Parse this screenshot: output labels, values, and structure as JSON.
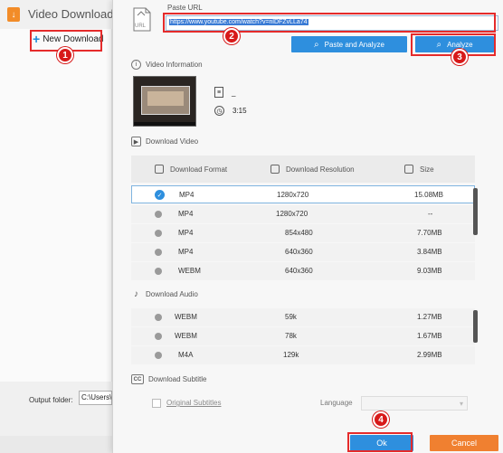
{
  "app": {
    "title": "Video Downloader",
    "new_download_label": "New Download",
    "output_folder_label": "Output folder:",
    "output_folder_value": "C:\\Users\\"
  },
  "dialog": {
    "url_icon_text": "URL",
    "paste_label": "Paste URL",
    "url_value": "https://www.youtube.com/watch?v=nlDFZvLLa74",
    "paste_analyze_label": "Paste and Analyze",
    "analyze_label": "Analyze",
    "video_info_label": "Video Information",
    "video_title": "_",
    "video_duration": "3:15",
    "download_video_label": "Download Video",
    "video_headers": {
      "format": "Download Format",
      "resolution": "Download Resolution",
      "size": "Size"
    },
    "video_rows": [
      {
        "format": "MP4",
        "resolution": "1280x720",
        "size": "15.08MB",
        "selected": true
      },
      {
        "format": "MP4",
        "resolution": "1280x720",
        "size": "--",
        "selected": false
      },
      {
        "format": "MP4",
        "resolution": "854x480",
        "size": "7.70MB",
        "selected": false
      },
      {
        "format": "MP4",
        "resolution": "640x360",
        "size": "3.84MB",
        "selected": false
      },
      {
        "format": "WEBM",
        "resolution": "640x360",
        "size": "9.03MB",
        "selected": false
      }
    ],
    "download_audio_label": "Download Audio",
    "audio_rows": [
      {
        "format": "WEBM",
        "bitrate": "59k",
        "size": "1.27MB"
      },
      {
        "format": "WEBM",
        "bitrate": "78k",
        "size": "1.67MB"
      },
      {
        "format": "M4A",
        "bitrate": "129k",
        "size": "2.99MB"
      }
    ],
    "download_subtitle_label": "Download Subtitle",
    "subtitle_cc": "CC",
    "original_subtitles_label": "Original Subtitles",
    "language_label": "Language",
    "language_value": "",
    "ok_label": "Ok",
    "cancel_label": "Cancel"
  },
  "annotations": [
    "1",
    "2",
    "3",
    "4"
  ],
  "colors": {
    "accent": "#2e8fde",
    "cancel": "#f08030",
    "annotation": "#e52b2b",
    "logo": "#f28c28"
  }
}
